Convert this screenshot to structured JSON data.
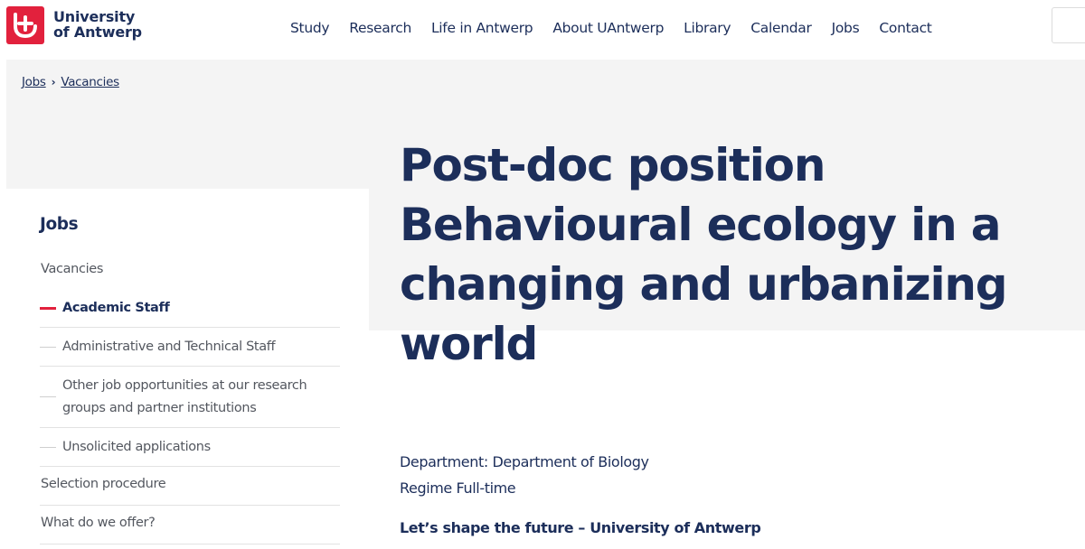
{
  "logo": {
    "line1": "University",
    "line2": "of Antwerp",
    "icon": "uantwerp-logo-icon",
    "brand_color": "#e2213d"
  },
  "nav": {
    "items": [
      "Study",
      "Research",
      "Life in Antwerp",
      "About UAntwerp",
      "Library",
      "Calendar",
      "Jobs",
      "Contact"
    ]
  },
  "breadcrumb": {
    "items": [
      "Jobs",
      "Vacancies"
    ],
    "separator_icon": "chevron-right-icon"
  },
  "sidebar": {
    "title": "Jobs",
    "vacancies": "Vacancies",
    "sub_items": [
      {
        "label": "Academic Staff",
        "active": true
      },
      {
        "label": "Administrative and Technical Staff",
        "active": false
      },
      {
        "label": "Other job opportunities at our research groups and partner institutions",
        "active": false
      },
      {
        "label": "Unsolicited applications",
        "active": false
      }
    ],
    "selection": "Selection procedure",
    "offer": "What do we offer?"
  },
  "main": {
    "title": "Post-doc position Behavioural ecology in a changing and urbanizing world",
    "department": "Department: Department of Biology",
    "regime": "Regime Full-time",
    "tagline": "Let’s shape the future – University of Antwerp"
  },
  "colors": {
    "navy": "#1c2e5a",
    "red": "#e2213d",
    "grey_band": "#f4f4f4"
  }
}
